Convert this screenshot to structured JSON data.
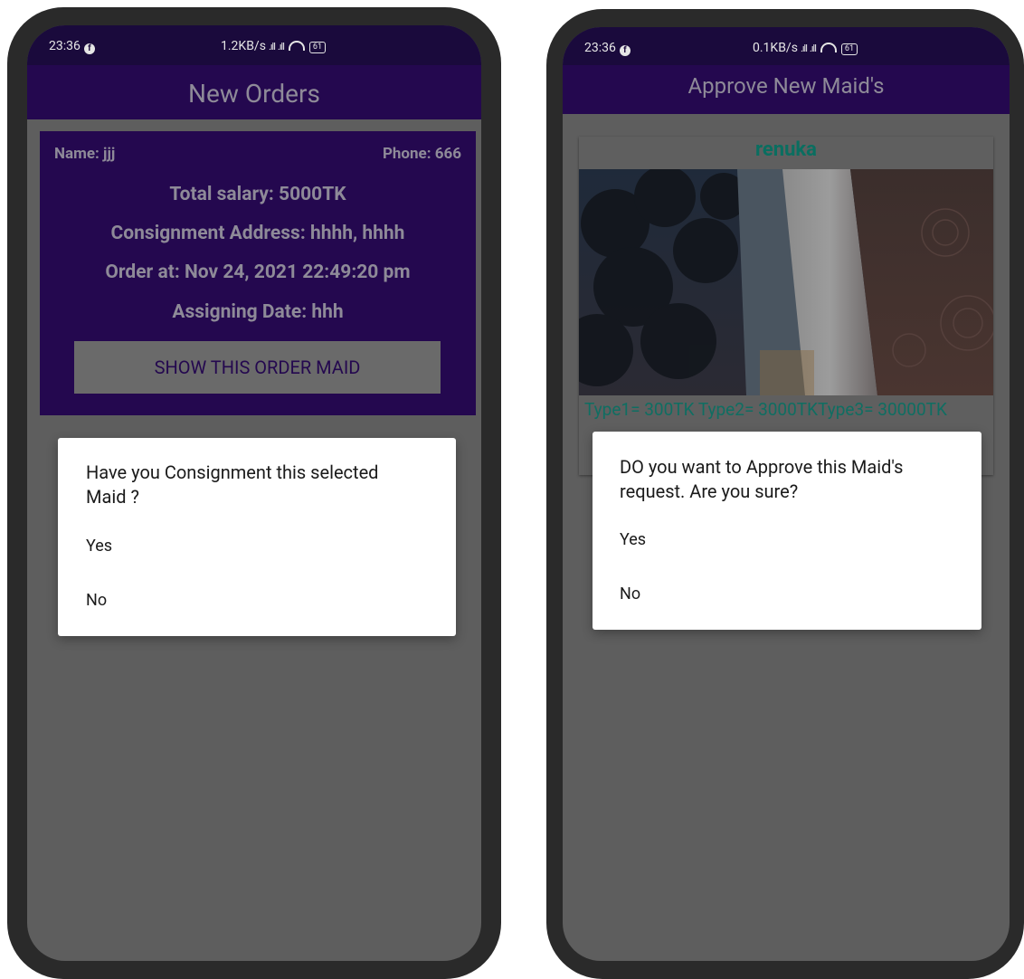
{
  "left_screen": {
    "status": {
      "time": "23:36",
      "speed": "1.2KB/s",
      "battery": "61"
    },
    "appbar_title": "New Orders",
    "order": {
      "name": "Name: jjj",
      "phone": "Phone: 666",
      "salary": "Total salary: 5000TK",
      "address": "Consignment Address: hhhh, hhhh",
      "order_at": "Order at: Nov 24, 2021 22:49:20 pm",
      "assigning_date": "Assigning Date: hhh",
      "button_label": "SHOW THIS ORDER MAID"
    },
    "dialog": {
      "title": "Have you Consignment this selected Maid ?",
      "yes": "Yes",
      "no": "No"
    }
  },
  "right_screen": {
    "status": {
      "time": "23:36",
      "speed": "0.1KB/s",
      "battery": "61"
    },
    "appbar_title": "Approve New Maid's",
    "maid": {
      "name": "renuka",
      "types": "Type1= 300TK  Type2= 3000TKType3= 30000TK"
    },
    "dialog": {
      "title": "DO you want to Approve this Maid's request. Are you sure?",
      "yes": "Yes",
      "no": "No"
    }
  },
  "colors": {
    "primary_dark": "#24084f",
    "status_bar": "#1a0a3c",
    "scrim_background": "#5e5e5e",
    "accent_teal": "#0a6e60"
  }
}
